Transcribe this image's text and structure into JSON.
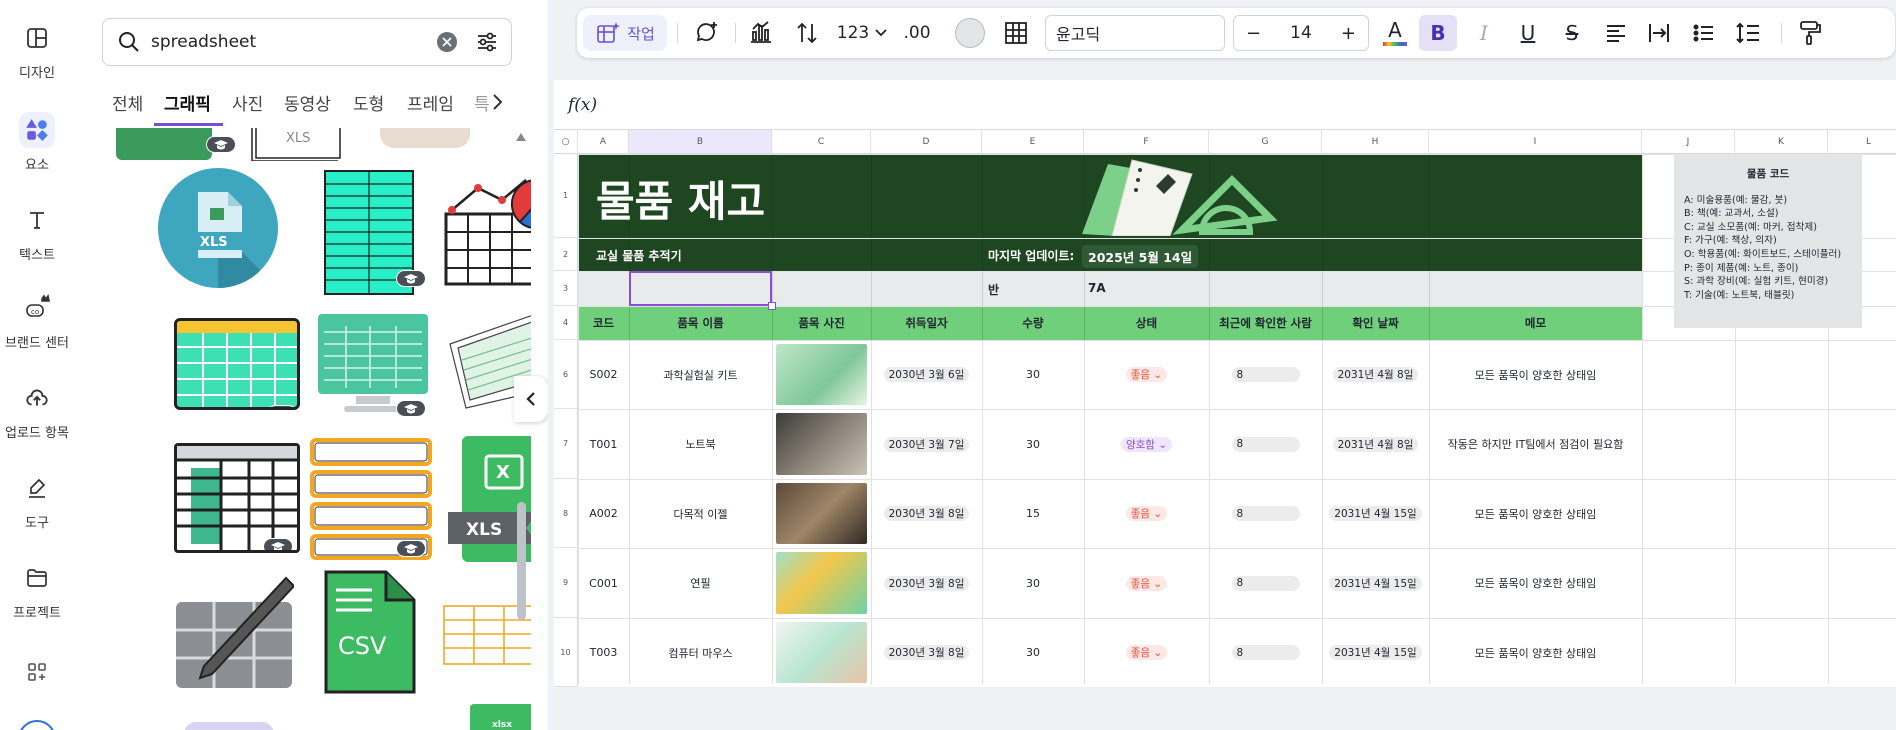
{
  "sidebar": {
    "items": [
      {
        "label": "디자인",
        "icon": "layout-icon"
      },
      {
        "label": "요소",
        "icon": "shapes-icon",
        "active": true
      },
      {
        "label": "텍스트",
        "icon": "text-icon"
      },
      {
        "label": "브랜드 센터",
        "icon": "brand-icon"
      },
      {
        "label": "업로드 항목",
        "icon": "upload-cloud-icon"
      },
      {
        "label": "도구",
        "icon": "draw-tool-icon"
      },
      {
        "label": "프로젝트",
        "icon": "folder-icon"
      }
    ]
  },
  "panel": {
    "search_query": "spreadsheet",
    "tabs": [
      "전체",
      "그래픽",
      "사진",
      "동영상",
      "도형",
      "프레임",
      "특"
    ],
    "active_tab": "그래픽",
    "tile_labels": {
      "xls_circle": "XLS",
      "xls_ribbon": "XLS",
      "csv": "CSV",
      "xlsx": "xlsx",
      "xls_top": "XLS"
    }
  },
  "toolbar": {
    "magic_label": "작업",
    "number_format": "123",
    "decimal": ".00",
    "font_name": "윤고딕",
    "font_size": "14",
    "minus": "−",
    "plus": "+",
    "bold": "B",
    "italic": "I",
    "underline": "U",
    "strike": "S",
    "text_color_letter": "A"
  },
  "formula_bar": {
    "label": "f(x)"
  },
  "sheet": {
    "columns": [
      "A",
      "B",
      "C",
      "D",
      "E",
      "F",
      "G",
      "H",
      "I",
      "J",
      "K",
      "L"
    ],
    "row_numbers": [
      "1",
      "2",
      "3",
      "4",
      "6",
      "7",
      "8",
      "9",
      "10"
    ],
    "title": "물품 재고",
    "subtitle": "교실 물품 추적기",
    "last_updated_label": "마지막 업데이트:",
    "last_updated_value": "2025년 5월 14일",
    "class_label": "반",
    "class_value": "7A",
    "headers": [
      "코드",
      "품목 이름",
      "품목 사진",
      "취득일자",
      "수량",
      "상태",
      "최근에 확인한 사람",
      "확인 날짜",
      "메모"
    ],
    "rows": [
      {
        "code": "S002",
        "name": "과학실험실 키트",
        "acquired": "2030년 3월 6일",
        "qty": "30",
        "status": "좋음",
        "checker": "8",
        "checked": "2031년 4월 8일",
        "memo": "모든 품목이 양호한 상태임"
      },
      {
        "code": "T001",
        "name": "노트북",
        "acquired": "2030년 3월 7일",
        "qty": "30",
        "status": "양호함",
        "checker": "8",
        "checked": "2031년 4월 8일",
        "memo": "작동은 하지만 IT팀에서 점검이 필요함"
      },
      {
        "code": "A002",
        "name": "다목적 이젤",
        "acquired": "2030년 3월 8일",
        "qty": "15",
        "status": "좋음",
        "checker": "8",
        "checked": "2031년 4월 15일",
        "memo": "모든 품목이 양호한 상태임"
      },
      {
        "code": "C001",
        "name": "연필",
        "acquired": "2030년 3월 8일",
        "qty": "30",
        "status": "좋음",
        "checker": "8",
        "checked": "2031년 4월 15일",
        "memo": "모든 품목이 양호한 상태임"
      },
      {
        "code": "T003",
        "name": "컴퓨터 마우스",
        "acquired": "2030년 3월 8일",
        "qty": "30",
        "status": "좋음",
        "checker": "8",
        "checked": "2031년 4월 15일",
        "memo": "모든 품목이 양호한 상태임"
      }
    ],
    "legend_title": "물품 코드",
    "legend_lines": [
      "A: 미술용품(예: 물감, 붓)",
      "B: 책(예: 교과서, 소설)",
      "C: 교실 소모품(예: 마커, 접착제)",
      "F: 가구(예: 책상, 의자)",
      "O: 학용품(예: 화이트보드, 스테이플러)",
      "P: 종이 제품(예: 노트, 종이)",
      "S: 과학 장비(예: 실험 키트, 현미경)",
      "T: 기술(예: 노트북, 태블릿)"
    ]
  },
  "colors": {
    "accent": "#7d4cdb",
    "dark_green": "#1e4620",
    "header_green": "#6fcf7a",
    "good_red": "#e5513c",
    "ok_purple": "#8a4fd6"
  }
}
